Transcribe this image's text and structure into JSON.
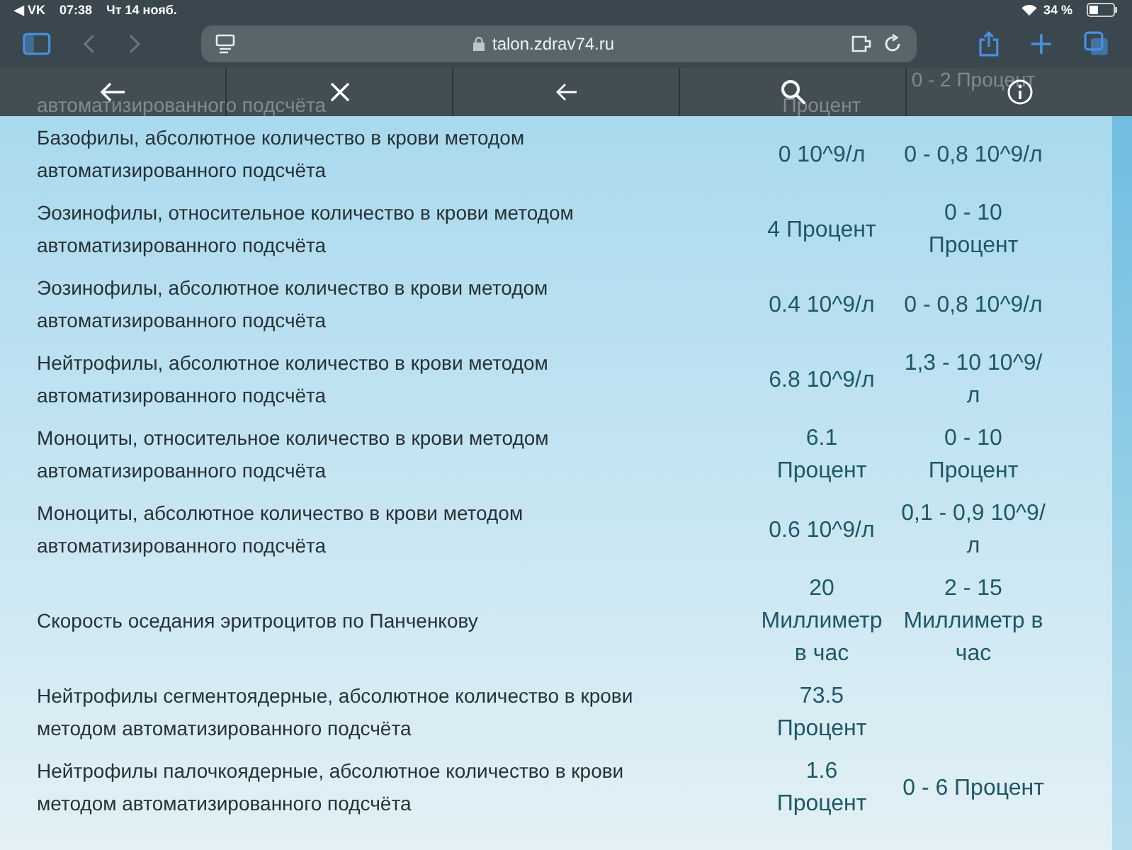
{
  "status_bar": {
    "back_app": "◀ VK",
    "time": "07:38",
    "date": "Чт 14 нояб.",
    "battery": "34 %"
  },
  "browser": {
    "url": "talon.zdrav74.ru"
  },
  "partial_row": {
    "name": "автоматизированного подсчёта",
    "value": "Процент",
    "range": "0 - 2 Процент"
  },
  "rows": [
    {
      "name": "Базофилы, абсолютное количество в крови методом автоматизированного подсчёта",
      "value": "0 10^9/л",
      "range": "0 - 0,8 10^9/л"
    },
    {
      "name": "Эозинофилы, относительное количество в крови методом автоматизированного подсчёта",
      "value": "4 Процент",
      "range": "0 - 10 Процент"
    },
    {
      "name": "Эозинофилы, абсолютное количество в крови методом автоматизированного подсчёта",
      "value": "0.4 10^9/л",
      "range": "0 - 0,8 10^9/л"
    },
    {
      "name": "Нейтрофилы, абсолютное количество в крови методом автоматизированного подсчёта",
      "value": "6.8 10^9/л",
      "range": "1,3 - 10 10^9/л"
    },
    {
      "name": "Моноциты, относительное количество в крови методом автоматизированного подсчёта",
      "value": "6.1 Процент",
      "range": "0 - 10 Процент"
    },
    {
      "name": "Моноциты, абсолютное количество в крови методом автоматизированного подсчёта",
      "value": "0.6 10^9/л",
      "range": "0,1 - 0,9 10^9/л"
    },
    {
      "name": "Скорость оседания эритроцитов по Панченкову",
      "value": "20 Миллиметр в час",
      "range": "2 - 15 Миллиметр в час"
    },
    {
      "name": "Нейтрофилы сегментоядерные, абсолютное количество в крови методом автоматизированного подсчёта",
      "value": "73.5 Процент"
    },
    {
      "name": "Нейтрофилы палочкоядерные, абсолютное количество в крови методом автоматизированного подсчёта",
      "value": "1.6 Процент",
      "range": "0 - 6 Процент"
    }
  ]
}
